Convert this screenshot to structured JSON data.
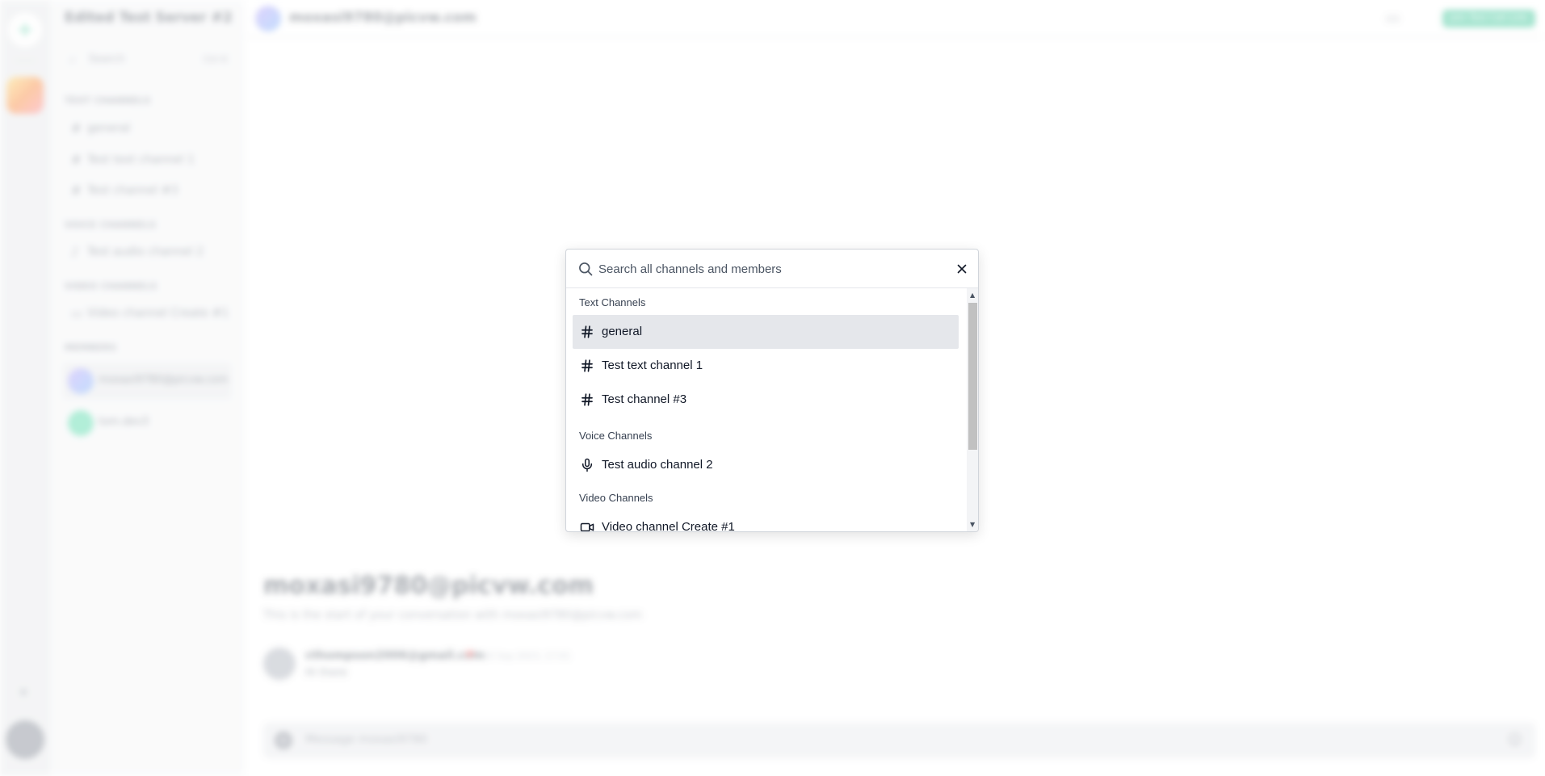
{
  "server": {
    "name": "Edited Test Server #2",
    "search_label": "Search",
    "search_shortcut": "Ctrl K"
  },
  "sidebar": {
    "text_category": "Text Channels",
    "text_channels": [
      "general",
      "Test text channel 1",
      "Test channel #3"
    ],
    "voice_category": "Voice Channels",
    "voice_channels": [
      "Test audio channel 2"
    ],
    "video_category": "Video Channels",
    "video_channels": [
      "Video channel Create #1"
    ],
    "members_category": "Members",
    "members": [
      "moxasi9780@picvw.com",
      "tom.dev3"
    ]
  },
  "main": {
    "header_name": "moxasi9780@picvw.com",
    "header_button": "Join Test Call Link",
    "big_name": "moxasi9780@picvw.com",
    "intro": "This is the start of your conversation with moxasi9780@picvw.com",
    "message": {
      "author": "cthompson2006@gmail.com",
      "time": "10 Sep 2023, 17:01",
      "text": "Hi there"
    },
    "composer_placeholder": "Message moxasi9780"
  },
  "dialog": {
    "search_placeholder": "Search all channels and members",
    "groups": {
      "text": "Text Channels",
      "voice": "Voice Channels",
      "video": "Video Channels"
    },
    "items": [
      {
        "label": "general",
        "icon": "hash-icon",
        "active": true
      },
      {
        "label": "Test text channel 1",
        "icon": "hash-icon",
        "active": false
      },
      {
        "label": "Test channel #3",
        "icon": "hash-icon",
        "active": false
      },
      {
        "label": "Test audio channel 2",
        "icon": "mic-icon",
        "active": false
      },
      {
        "label": "Video channel Create #1",
        "icon": "video-icon",
        "active": false
      }
    ]
  },
  "colors": {
    "accent": "#10b981",
    "active_item": "#e5e7eb"
  }
}
